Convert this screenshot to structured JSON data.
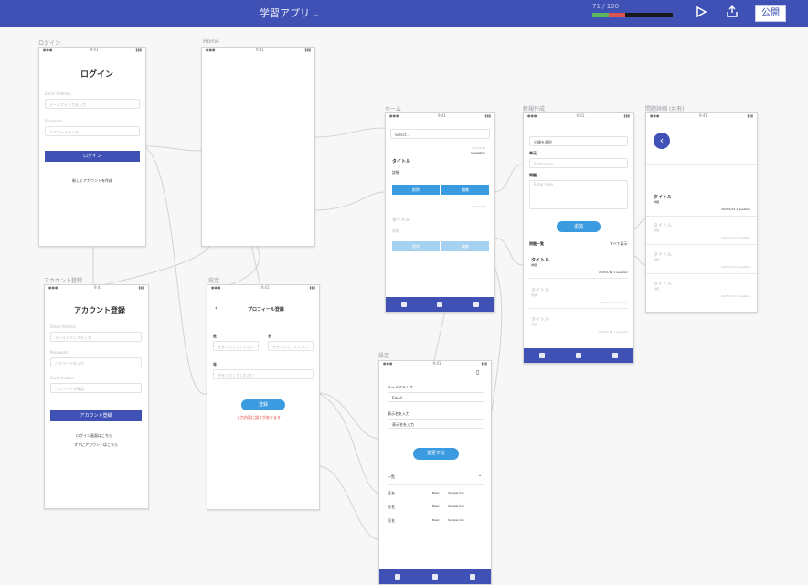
{
  "header": {
    "app_title": "学習アプリ",
    "usage": "71 / 100",
    "usage_fraction": 0.71,
    "publish_label": "公開",
    "icons": [
      "play-icon",
      "export-icon",
      "chevron-down-icon"
    ],
    "brand_color": "#3f51b5"
  },
  "screens": {
    "login": {
      "label": "ログイン",
      "title": "ログイン",
      "email_label": "Email Address",
      "email_placeholder": "メールアドレスを入力",
      "password_label": "Password",
      "password_placeholder": "パスワードを入力",
      "button": "ログイン",
      "link": "新しくアカウントを作成"
    },
    "blank": {
      "label": "Home"
    },
    "signup": {
      "label": "アカウント登録",
      "title": "アカウント登録",
      "email_label": "Email Address",
      "email_placeholder": "メールアドレスを入力",
      "password_label": "Password",
      "password_placeholder": "パスワードを入力",
      "confirm_label": "Confirmation",
      "confirm_placeholder": "パスワードを確認",
      "button": "アカウント登録",
      "link1": "ログイン画面はこちら",
      "link2": "すでにアカウントはこちら"
    },
    "profile": {
      "label": "設定",
      "title": "プロフィール登録",
      "col1_label": "姓",
      "col1_placeholder": "姓を入力してください",
      "col2_label": "名",
      "col2_placeholder": "名を入力してください",
      "row_label": "年",
      "row_placeholder": "年を入力してください",
      "button": "登録",
      "error": "入力内容に誤りがあります"
    },
    "home": {
      "label": "ホーム",
      "select": "Select...",
      "item1_date": "2023/1/12",
      "item1_meta": "1 question",
      "item1_title": "タイトル",
      "item1_sub": "詳細",
      "btn_a": "削除",
      "btn_b": "編集",
      "item2_date": "2023/1/12",
      "item2_title": "タイトル",
      "item2_sub": "詳細",
      "btn_c": "削除",
      "btn_d": "編集"
    },
    "settings": {
      "label": "設定",
      "email_label": "メールアドレス",
      "email_value": "Email",
      "name_label": "表示名を入力",
      "name_value": "表示名を入力",
      "button": "変更する",
      "section": "一覧",
      "rows": [
        {
          "a": "氏名",
          "b": "Basic",
          "c": "Sample Info"
        },
        {
          "a": "氏名",
          "b": "Basic",
          "c": "Sample Info"
        },
        {
          "a": "氏名",
          "b": "Basic",
          "c": "Sample Info"
        }
      ]
    },
    "create": {
      "label": "新規作成",
      "select": "分類を選択",
      "title_label": "単元",
      "title_placeholder": "Enter here",
      "body_label": "問題",
      "body_placeholder": "Enter here",
      "button": "追加",
      "list_title": "問題一覧",
      "list_right": "すべて表示",
      "items": [
        {
          "t": "タイトル",
          "s": "詳細",
          "d": "2023/1/12 1 question"
        },
        {
          "t": "タイトル",
          "s": "詳細",
          "d": "2023/1/12 1 question"
        },
        {
          "t": "タイトル",
          "s": "詳細",
          "d": "2023/1/12 1 question"
        }
      ]
    },
    "detail": {
      "label": "問題詳細 (共有)",
      "items": [
        {
          "t": "タイトル",
          "s": "詳細",
          "d": "2023/1/12 1 question"
        },
        {
          "t": "タイトル",
          "s": "詳細",
          "d": "2023/1/12 1 question"
        },
        {
          "t": "タイトル",
          "s": "詳細",
          "d": "2023/1/12 1 question"
        },
        {
          "t": "タイトル",
          "s": "詳細",
          "d": "2023/1/12 1 question"
        }
      ]
    }
  }
}
